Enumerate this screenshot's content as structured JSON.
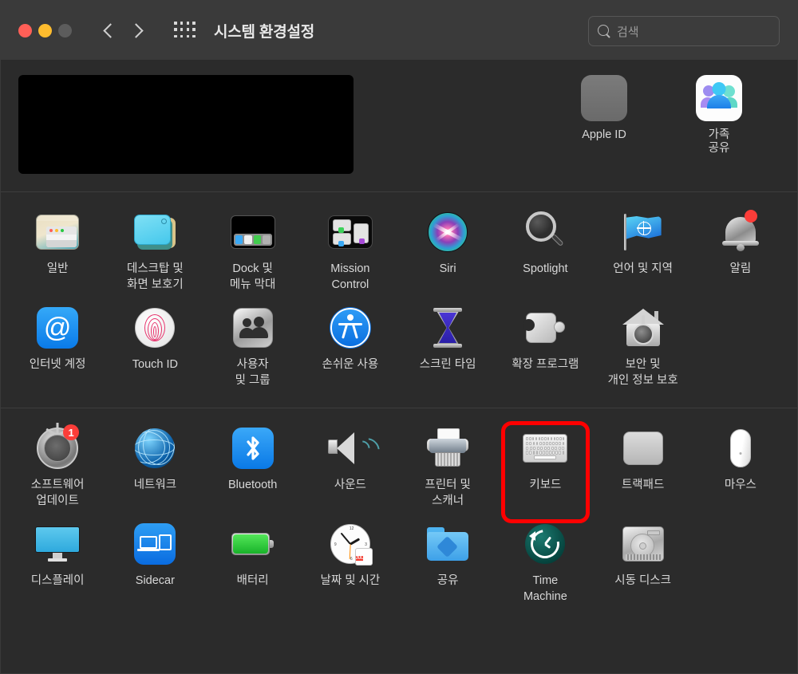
{
  "window": {
    "title": "시스템 환경설정",
    "traffic_lights": [
      "close",
      "minimize",
      "zoom"
    ],
    "nav": {
      "back": "뒤로",
      "forward": "앞으로"
    },
    "grid_button": "모두 보기",
    "search": {
      "placeholder": "검색",
      "value": ""
    }
  },
  "account_section": {
    "redacted_label": "",
    "items": [
      {
        "name": "apple-id",
        "label": "Apple ID",
        "icon": "apple-logo"
      },
      {
        "name": "family-sharing",
        "label": "가족\n공유",
        "icon": "family-group"
      }
    ]
  },
  "sections": [
    {
      "name": "personal",
      "rows": [
        [
          {
            "name": "general",
            "label": "일반",
            "icon": "general-window"
          },
          {
            "name": "desktop-screensaver",
            "label": "데스크탑 및\n화면 보호기",
            "icon": "desktop-stack"
          },
          {
            "name": "dock-menubar",
            "label": "Dock 및\n메뉴 막대",
            "icon": "dock-tray"
          },
          {
            "name": "mission-control",
            "label": "Mission\nControl",
            "icon": "mission-control-windows"
          },
          {
            "name": "siri",
            "label": "Siri",
            "icon": "siri-orb"
          },
          {
            "name": "spotlight",
            "label": "Spotlight",
            "icon": "magnifier"
          },
          {
            "name": "language-region",
            "label": "언어 및 지역",
            "icon": "flag-globe"
          },
          {
            "name": "notifications",
            "label": "알림",
            "icon": "bell",
            "badge": "",
            "badge_type": "dot"
          }
        ],
        [
          {
            "name": "internet-accounts",
            "label": "인터넷 계정",
            "icon": "at-sign"
          },
          {
            "name": "touch-id",
            "label": "Touch ID",
            "icon": "fingerprint"
          },
          {
            "name": "users-groups",
            "label": "사용자\n및 그룹",
            "icon": "two-people"
          },
          {
            "name": "accessibility",
            "label": "손쉬운 사용",
            "icon": "accessibility-person"
          },
          {
            "name": "screen-time",
            "label": "스크린 타임",
            "icon": "hourglass"
          },
          {
            "name": "extensions",
            "label": "확장 프로그램",
            "icon": "puzzle-piece"
          },
          {
            "name": "security-privacy",
            "label": "보안 및\n개인 정보 보호",
            "icon": "house-lock"
          }
        ]
      ]
    },
    {
      "name": "hardware",
      "rows": [
        [
          {
            "name": "software-update",
            "label": "소프트웨어\n업데이트",
            "icon": "gear",
            "badge": "1",
            "badge_type": "count"
          },
          {
            "name": "network",
            "label": "네트워크",
            "icon": "globe-mesh"
          },
          {
            "name": "bluetooth",
            "label": "Bluetooth",
            "icon": "bluetooth-rune"
          },
          {
            "name": "sound",
            "label": "사운드",
            "icon": "speaker-waves"
          },
          {
            "name": "printers-scanners",
            "label": "프린터 및\n스캐너",
            "icon": "printer"
          },
          {
            "name": "keyboard",
            "label": "키보드",
            "icon": "keyboard",
            "highlighted": true
          },
          {
            "name": "trackpad",
            "label": "트랙패드",
            "icon": "trackpad"
          },
          {
            "name": "mouse",
            "label": "마우스",
            "icon": "mouse"
          }
        ],
        [
          {
            "name": "displays",
            "label": "디스플레이",
            "icon": "monitor"
          },
          {
            "name": "sidecar",
            "label": "Sidecar",
            "icon": "laptop-ipad"
          },
          {
            "name": "battery",
            "label": "배터리",
            "icon": "battery-green"
          },
          {
            "name": "date-time",
            "label": "날짜 및 시간",
            "icon": "clock-calendar",
            "calendar_month": "JUL",
            "calendar_day": "17"
          },
          {
            "name": "sharing",
            "label": "공유",
            "icon": "folder-share"
          },
          {
            "name": "time-machine",
            "label": "Time\nMachine",
            "icon": "time-machine-clock"
          },
          {
            "name": "startup-disk",
            "label": "시동 디스크",
            "icon": "hard-disk"
          }
        ]
      ]
    }
  ],
  "annotation": {
    "name": "keyboard-highlight",
    "color": "#ff0000",
    "target": "키보드"
  },
  "colors": {
    "window_bg": "#2b2b2b",
    "toolbar_bg": "#3a3a3a",
    "label_text": "#d8d8d8",
    "badge_red": "#fc3d39",
    "accent_blue": "#0a7ae8",
    "highlight": "#ff0000"
  }
}
